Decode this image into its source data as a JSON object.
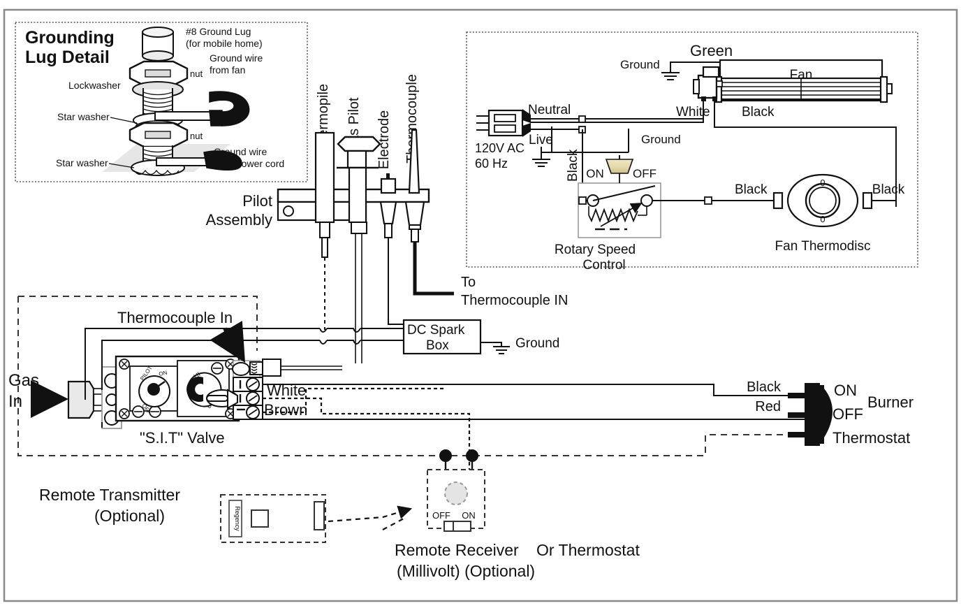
{
  "document": {
    "title": "Gas Fireplace Wiring Diagram",
    "frame_color": "#888888",
    "line_color": "#1a1a1a"
  },
  "grounding_panel": {
    "title_line1": "Grounding",
    "title_line2": "Lug Detail",
    "lug_label_line1": "#8 Ground Lug",
    "lug_label_line2": "(for mobile home)",
    "nut_top": "nut",
    "nut_bottom": "nut",
    "lockwasher": "Lockwasher",
    "star_washer_top": "Star washer",
    "star_washer_bottom": "Star washer",
    "ground_wire_fan_line1": "Ground wire",
    "ground_wire_fan_line2": "from fan",
    "ground_wire_cord_line1": "Ground wire",
    "ground_wire_cord_line2": "from power cord"
  },
  "pilot_assembly": {
    "label_line1": "Pilot",
    "label_line2": "Assembly",
    "components": [
      {
        "name": "Thermopile"
      },
      {
        "name": "Gas Pilot"
      },
      {
        "name": "Electrode"
      },
      {
        "name": "Thermocouple"
      }
    ],
    "to_thermocouple_line1": "To",
    "to_thermocouple_line2": "Thermocouple IN"
  },
  "fan_panel": {
    "ground_label": "Ground",
    "green_label": "Green",
    "fan_label": "Fan",
    "neutral_label": "Neutral",
    "live_label": "Live",
    "white_label": "White",
    "black_fan_label": "Black",
    "black_vertical_label": "Black",
    "black_left_label": "Black",
    "black_right_label": "Black",
    "ground_mid_label": "Ground",
    "supply_line1": "120V AC",
    "supply_line2": "60 Hz",
    "switch_on": "ON",
    "switch_off": "OFF",
    "rotary_line1": "Rotary Speed",
    "rotary_line2": "Control",
    "thermodisc_label": "Fan Thermodisc",
    "thermodisc_mark_top": "0",
    "thermodisc_mark_bottom": "0",
    "knob_color": "#e8dfb8"
  },
  "spark_box": {
    "line1": "DC Spark",
    "line2": "Box",
    "ground_label": "Ground"
  },
  "valve": {
    "gas_in_line1": "Gas",
    "gas_in_line2": "In",
    "thermocouple_in": "Thermocouple In",
    "name": "\"S.I.T\" Valve",
    "dial_pilot": "PILOT",
    "dial_on": "ON",
    "dial_off": "OFF",
    "knob_hi": "HI",
    "knob_lo": "LO",
    "wire_white": "White",
    "wire_brown": "Brown"
  },
  "burner_thermostat": {
    "black_label": "Black",
    "red_label": "Red",
    "on_label": "ON",
    "off_label": "OFF",
    "burner_label": "Burner",
    "thermostat_label": "Thermostat"
  },
  "remote": {
    "transmitter_line1": "Remote Transmitter",
    "transmitter_line2": "(Optional)",
    "brand": "Regency",
    "receiver_line1": "Remote Receiver",
    "receiver_line2": "(Millivolt) (Optional)",
    "receiver_off": "OFF",
    "receiver_on": "ON",
    "or_thermostat": "Or Thermostat"
  }
}
